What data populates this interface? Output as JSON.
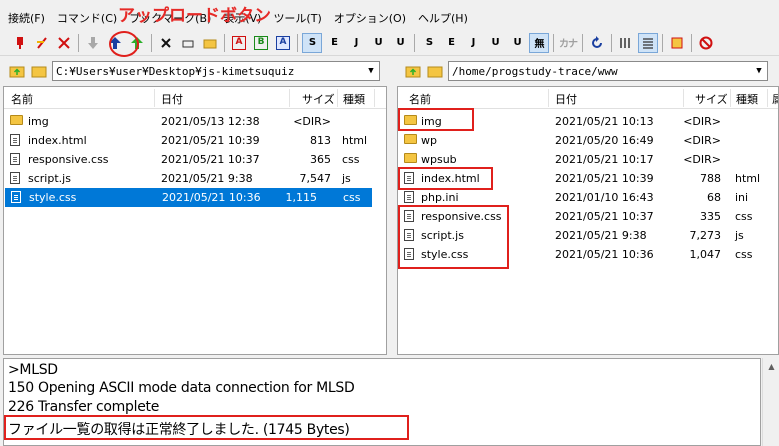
{
  "menu": [
    "接続(F)",
    "コマンド(C)",
    "ブックマーク(B)",
    "表示(V)",
    "ツール(T)",
    "オプション(O)",
    "ヘルプ(H)"
  ],
  "annotation": "アップロードボタン",
  "toolbar": {
    "icons": [
      "connect-icon",
      "quick-connect-icon",
      "disconnect-icon",
      "download-icon",
      "upload-icon",
      "mirror-upload-icon",
      "delete-icon",
      "rename-icon",
      "mkdir-icon",
      "ascii-mode-icon",
      "binary-mode-icon",
      "auto-mode-icon"
    ],
    "kana": "カナ"
  },
  "local": {
    "path": "C:¥Users¥user¥Desktop¥js-kimetsuquiz",
    "columns": {
      "name": "名前",
      "date": "日付",
      "size": "サイズ",
      "type": "種類"
    },
    "files": [
      {
        "name": "img",
        "date": "2021/05/13 12:38",
        "size": "<DIR>",
        "type": "",
        "kind": "folder"
      },
      {
        "name": "index.html",
        "date": "2021/05/21 10:39",
        "size": "813",
        "type": "html",
        "kind": "file"
      },
      {
        "name": "responsive.css",
        "date": "2021/05/21 10:37",
        "size": "365",
        "type": "css",
        "kind": "file"
      },
      {
        "name": "script.js",
        "date": "2021/05/21 9:38",
        "size": "7,547",
        "type": "js",
        "kind": "file"
      },
      {
        "name": "style.css",
        "date": "2021/05/21 10:36",
        "size": "1,115",
        "type": "css",
        "kind": "file",
        "selected": true
      }
    ]
  },
  "remote": {
    "path": "/home/progstudy-trace/www",
    "columns": {
      "name": "名前",
      "date": "日付",
      "size": "サイズ",
      "type": "種類",
      "extra": "属"
    },
    "files": [
      {
        "name": "img",
        "date": "2021/05/21 10:13",
        "size": "<DIR>",
        "type": "",
        "kind": "folder"
      },
      {
        "name": "wp",
        "date": "2021/05/20 16:49",
        "size": "<DIR>",
        "type": "",
        "kind": "folder"
      },
      {
        "name": "wpsub",
        "date": "2021/05/21 10:17",
        "size": "<DIR>",
        "type": "",
        "kind": "folder"
      },
      {
        "name": "index.html",
        "date": "2021/05/21 10:39",
        "size": "788",
        "type": "html",
        "kind": "file"
      },
      {
        "name": "php.ini",
        "date": "2021/01/10 16:43",
        "size": "68",
        "type": "ini",
        "kind": "file"
      },
      {
        "name": "responsive.css",
        "date": "2021/05/21 10:37",
        "size": "335",
        "type": "css",
        "kind": "file"
      },
      {
        "name": "script.js",
        "date": "2021/05/21 9:38",
        "size": "7,273",
        "type": "js",
        "kind": "file"
      },
      {
        "name": "style.css",
        "date": "2021/05/21 10:36",
        "size": "1,047",
        "type": "css",
        "kind": "file"
      }
    ]
  },
  "log": [
    ">MLSD",
    "150 Opening ASCII mode data connection for MLSD",
    "226 Transfer complete",
    "ファイル一覧の取得は正常終了しました. (1745 Bytes)"
  ],
  "colors": {
    "highlight": "#e0201c",
    "selection": "#0078d7",
    "annotation": "#e62a27"
  }
}
